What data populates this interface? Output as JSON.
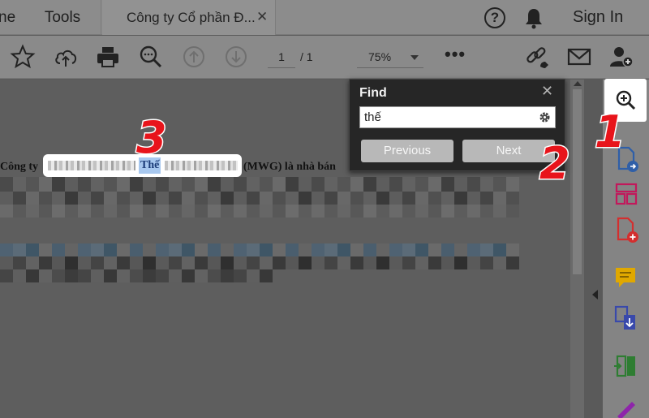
{
  "tabs": {
    "home_label": "ne",
    "tools_label": "Tools",
    "document_title": "Công ty Cổ phần Đ...",
    "close_symbol": "✕"
  },
  "header": {
    "help_symbol": "?",
    "sign_in_label": "Sign In"
  },
  "toolbar": {
    "current_page": "1",
    "page_total": "/ 1",
    "zoom_level": "75%",
    "more_symbol": "•••",
    "icons": [
      "star-icon",
      "cloud-upload-icon",
      "print-icon",
      "zoom-search-icon",
      "page-up-icon",
      "page-down-icon",
      "share-link-icon",
      "mail-icon",
      "add-user-icon"
    ]
  },
  "find": {
    "title": "Find",
    "close_symbol": "✕",
    "query": "thế",
    "previous_label": "Previous",
    "next_label": "Next"
  },
  "document": {
    "line1_start": "Công ty",
    "highlighted_word": "Thế",
    "line1_mid": "(MWG) là nhà bán"
  },
  "markers": {
    "step1": "1",
    "step2": "2",
    "step3": "3"
  },
  "right_rail": {
    "icons": [
      "find-zoom-icon",
      "export-pdf-icon",
      "organize-pages-icon",
      "create-pdf-icon",
      "comment-icon",
      "compress-icon",
      "combine-icon",
      "fill-sign-icon"
    ]
  },
  "colors": {
    "marker_red": "#e8141b",
    "highlight_blue": "#a8c8ef",
    "dialog_bg": "#262626"
  }
}
